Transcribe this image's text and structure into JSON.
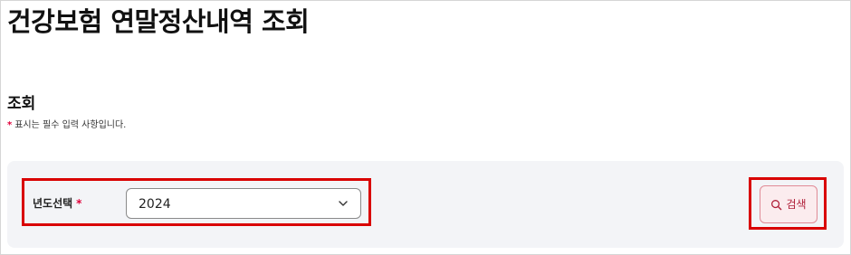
{
  "header": {
    "title": "건강보험 연말정산내역 조회"
  },
  "section": {
    "title": "조회",
    "required_star": "*",
    "required_note": "표시는 필수 입력 사항입니다."
  },
  "search_form": {
    "year_label": "년도선택",
    "year_required_star": "*",
    "year_value": "2024",
    "search_button_label": "검색"
  },
  "icons": {
    "select": "chevron-down-icon",
    "search": "search-icon"
  },
  "colors": {
    "required": "#e0003a",
    "highlight": "#d90000",
    "search_button_bg": "#fbecee",
    "search_button_text": "#b0203a",
    "panel_bg": "#f3f4f7"
  }
}
